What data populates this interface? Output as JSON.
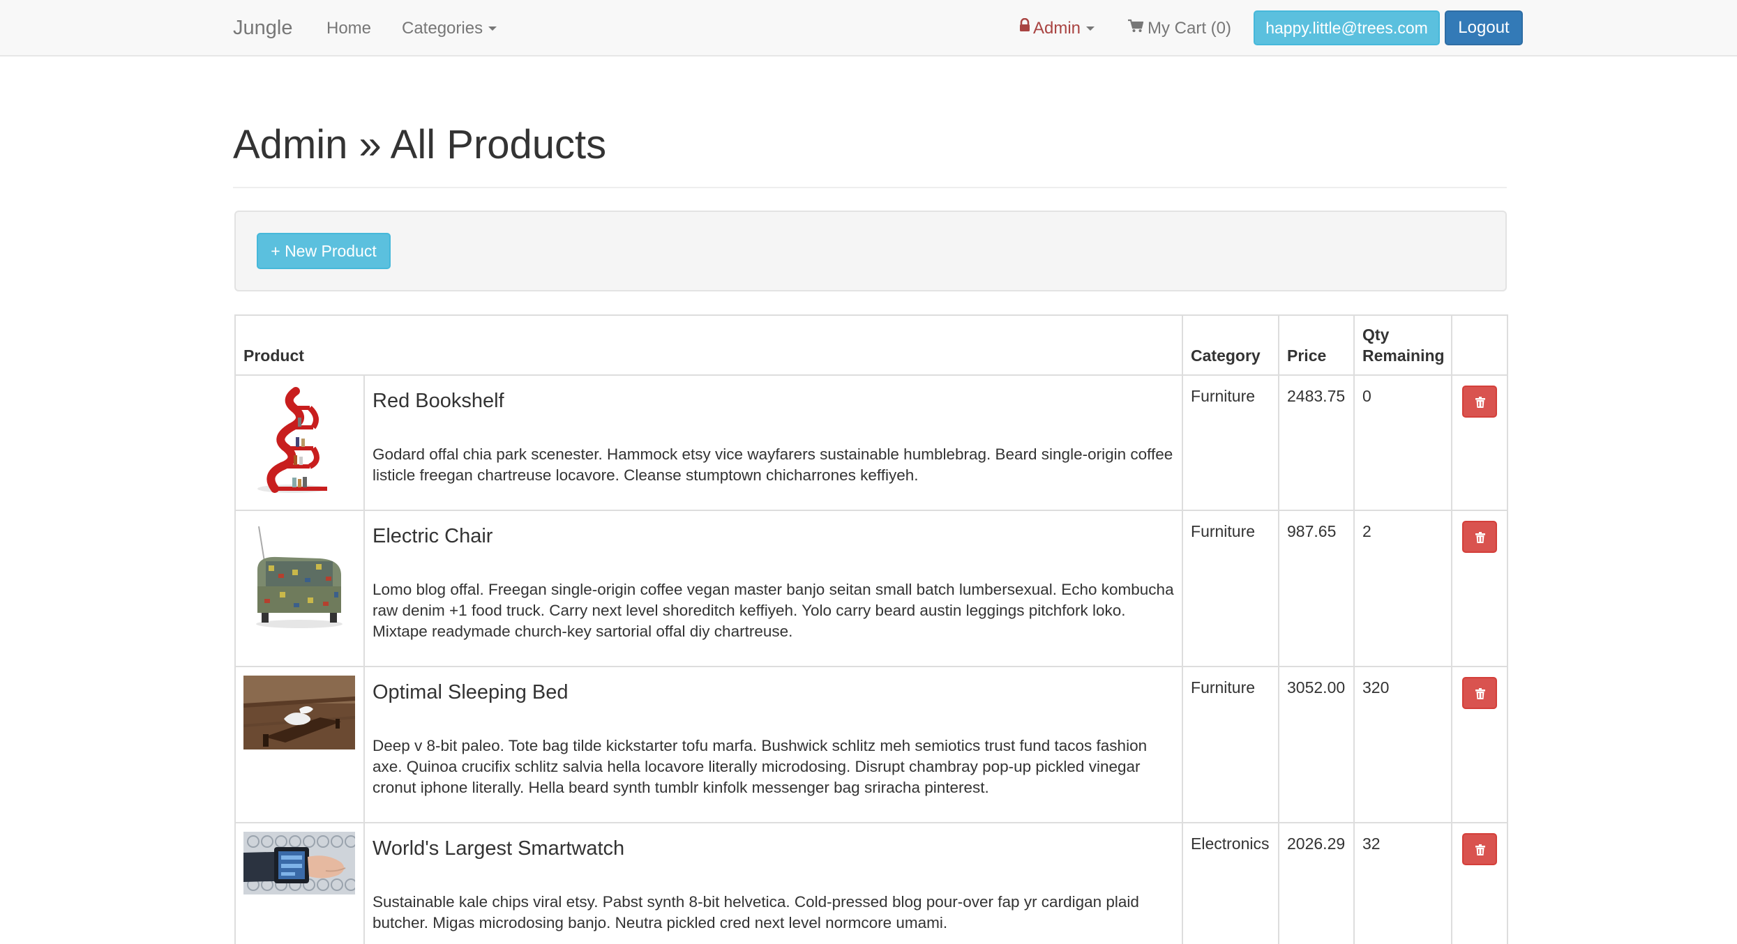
{
  "navbar": {
    "brand": "Jungle",
    "home": "Home",
    "categories": "Categories",
    "admin": "Admin",
    "cart": "My Cart (0)",
    "email": "happy.little@trees.com",
    "logout": "Logout"
  },
  "page": {
    "title": "Admin » All Products",
    "new_product": "+ New Product"
  },
  "table": {
    "headers": {
      "product": "Product",
      "category": "Category",
      "price": "Price",
      "qty_line1": "Qty",
      "qty_line2": "Remaining"
    },
    "rows": [
      {
        "name": "Red Bookshelf",
        "description": "Godard offal chia park scenester. Hammock etsy vice wayfarers sustainable humblebrag. Beard single-origin coffee listicle freegan chartreuse locavore. Cleanse stumptown chicharrones keffiyeh.",
        "category": "Furniture",
        "price": "2483.75",
        "qty": "0"
      },
      {
        "name": "Electric Chair",
        "description": "Lomo blog offal. Freegan single-origin coffee vegan master banjo seitan small batch lumbersexual. Echo kombucha raw denim +1 food truck. Carry next level shoreditch keffiyeh. Yolo carry beard austin leggings pitchfork loko. Mixtape readymade church-key sartorial offal diy chartreuse.",
        "category": "Furniture",
        "price": "987.65",
        "qty": "2"
      },
      {
        "name": "Optimal Sleeping Bed",
        "description": "Deep v 8-bit paleo. Tote bag tilde kickstarter tofu marfa. Bushwick schlitz meh semiotics trust fund tacos fashion axe. Quinoa crucifix schlitz salvia hella locavore literally microdosing. Disrupt chambray pop-up pickled vinegar cronut iphone literally. Hella beard synth tumblr kinfolk messenger bag sriracha pinterest.",
        "category": "Furniture",
        "price": "3052.00",
        "qty": "320"
      },
      {
        "name": "World's Largest Smartwatch",
        "description": "Sustainable kale chips viral etsy. Pabst synth 8-bit helvetica. Cold-pressed blog pour-over fap yr cardigan plaid butcher. Migas microdosing banjo. Neutra pickled cred next level normcore umami.",
        "category": "Electronics",
        "price": "2026.29",
        "qty": "32"
      }
    ]
  },
  "colors": {
    "info": "#5bc0de",
    "primary": "#337ab7",
    "danger": "#d9534f",
    "admin_text": "#a94442"
  }
}
